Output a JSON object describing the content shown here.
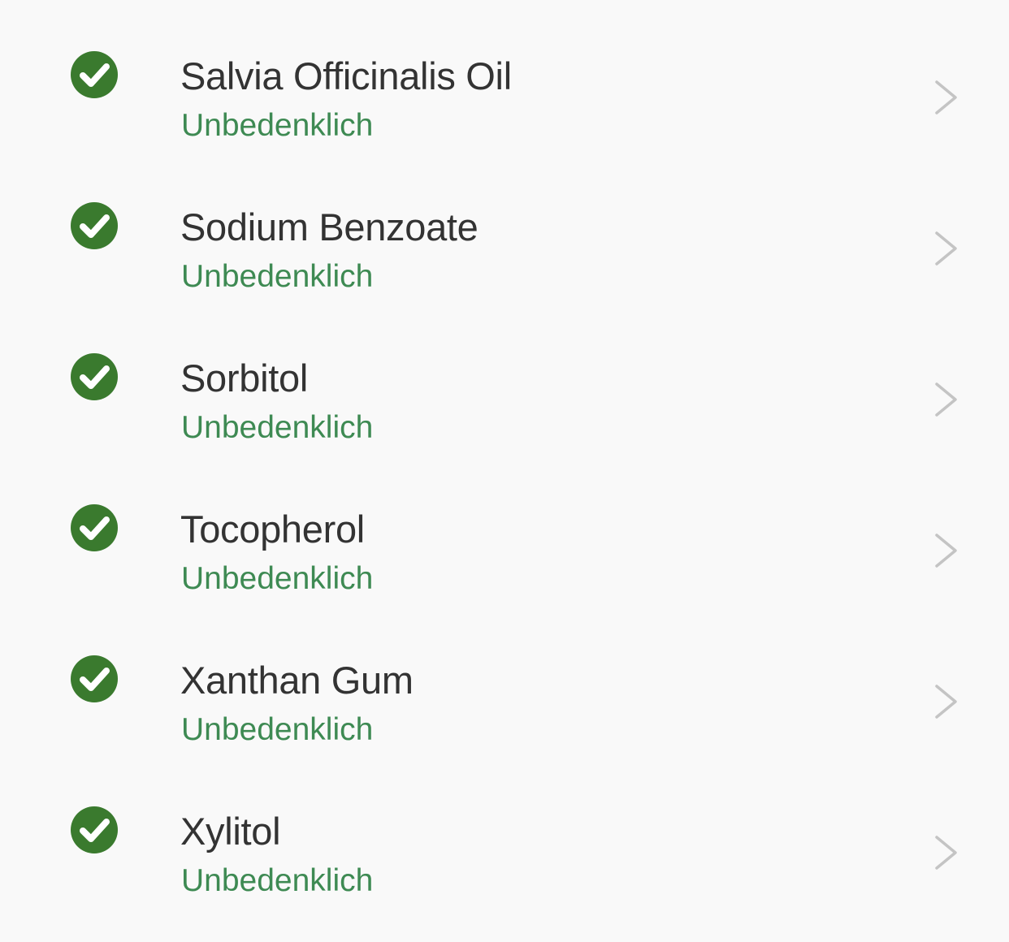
{
  "theme": {
    "check_color": "#3a7a2e",
    "status_color": "#3e8a53",
    "chevron_color": "#c4c4c4"
  },
  "ingredients": [
    {
      "name": "Salvia Officinalis Oil",
      "rating": "Unbedenklich",
      "icon": "check-circle-icon"
    },
    {
      "name": "Sodium Benzoate",
      "rating": "Unbedenklich",
      "icon": "check-circle-icon"
    },
    {
      "name": "Sorbitol",
      "rating": "Unbedenklich",
      "icon": "check-circle-icon"
    },
    {
      "name": "Tocopherol",
      "rating": "Unbedenklich",
      "icon": "check-circle-icon"
    },
    {
      "name": "Xanthan Gum",
      "rating": "Unbedenklich",
      "icon": "check-circle-icon"
    },
    {
      "name": "Xylitol",
      "rating": "Unbedenklich",
      "icon": "check-circle-icon"
    }
  ]
}
